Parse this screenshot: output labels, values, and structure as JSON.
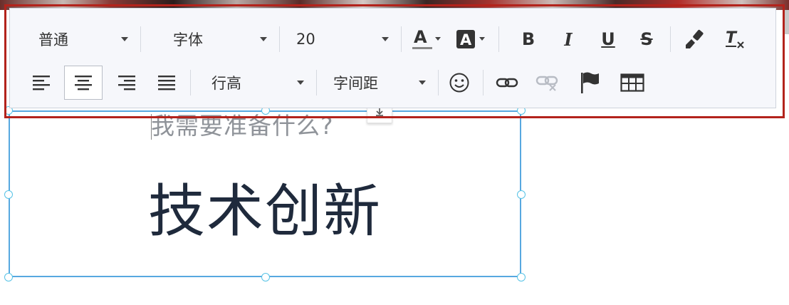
{
  "toolbar": {
    "row1": {
      "paragraph_select": "普通",
      "font_select": "字体",
      "size_select": "20",
      "font_color_icon": "font-color-icon",
      "bg_color_icon": "background-color-icon",
      "bold_label": "B",
      "italic_label": "I",
      "underline_label": "U",
      "strike_label": "S",
      "format_painter_icon": "paint-brush-icon",
      "clear_format_label": "T"
    },
    "row2": {
      "line_height_select": "行高",
      "letter_spacing_select": "字间距",
      "align_active": "center"
    }
  },
  "editor": {
    "placeholder": "我需要准备什么?",
    "content": "技术创新"
  },
  "colors": {
    "highlight_border": "#b3231c",
    "selection_border": "#57a8e0",
    "text": "#1f2a3c"
  }
}
